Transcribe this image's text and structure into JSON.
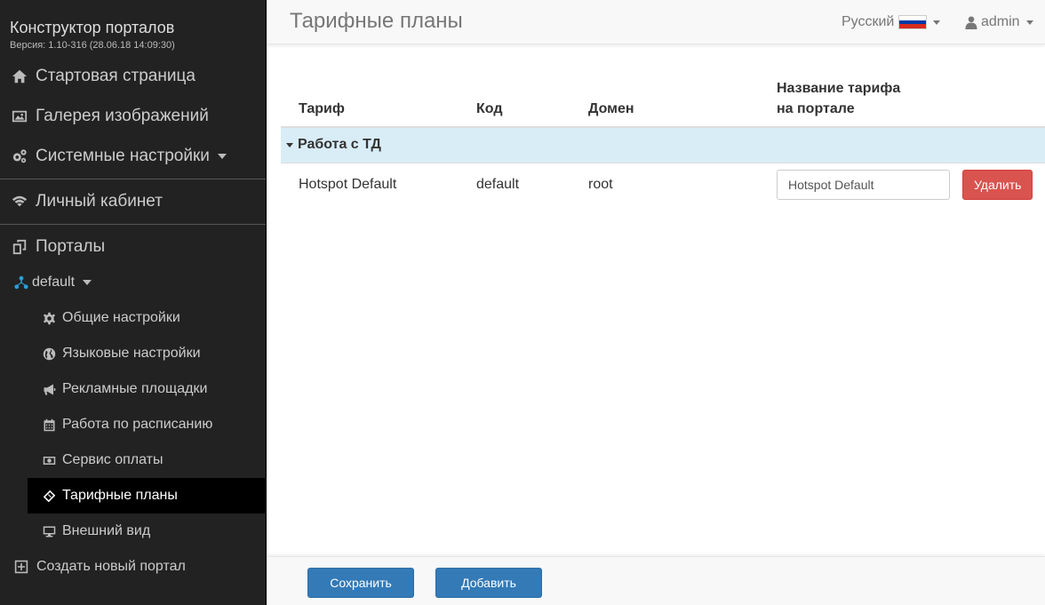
{
  "brand": {
    "title": "Конструктор порталов",
    "version": "Версия: 1.10-316 (28.06.18 14:09:30)"
  },
  "sidebar": {
    "main": [
      {
        "label": "Стартовая страница",
        "icon": "home-icon"
      },
      {
        "label": "Галерея изображений",
        "icon": "image-icon"
      },
      {
        "label": "Системные настройки",
        "icon": "cogs-icon"
      }
    ],
    "cabinet": {
      "label": "Личный кабинет",
      "icon": "wifi-icon"
    },
    "portals": {
      "label": "Порталы",
      "icon": "copy-icon"
    },
    "portal_default": {
      "label": "default",
      "icon": "sitemap-icon"
    },
    "sub": [
      {
        "label": "Общие настройки",
        "icon": "gear-icon"
      },
      {
        "label": "Языковые настройки",
        "icon": "globe-icon"
      },
      {
        "label": "Рекламные площадки",
        "icon": "bullhorn-icon"
      },
      {
        "label": "Работа по расписанию",
        "icon": "calendar-icon"
      },
      {
        "label": "Сервис оплаты",
        "icon": "money-icon"
      },
      {
        "label": "Тарифные планы",
        "icon": "ticket-icon",
        "active": true
      },
      {
        "label": "Внешний вид",
        "icon": "desktop-icon"
      }
    ],
    "create_portal": {
      "label": "Создать новый портал",
      "icon": "plus-square-icon"
    }
  },
  "header": {
    "title": "Тарифные планы",
    "language": "Русский",
    "user": "admin"
  },
  "table": {
    "headers": [
      "Тариф",
      "Код",
      "Домен",
      "Название тарифа на портале"
    ],
    "group": "Работа с ТД",
    "rows": [
      {
        "tariff": "Hotspot Default",
        "code": "default",
        "domain": "root",
        "portal_name": "Hotspot Default",
        "delete_label": "Удалить"
      }
    ]
  },
  "footer": {
    "save_label": "Сохранить",
    "add_label": "Добавить"
  },
  "colors": {
    "sidebar_bg": "#222222",
    "primary": "#337ab7",
    "danger": "#d9534f",
    "group_bg": "#d9edf7"
  }
}
